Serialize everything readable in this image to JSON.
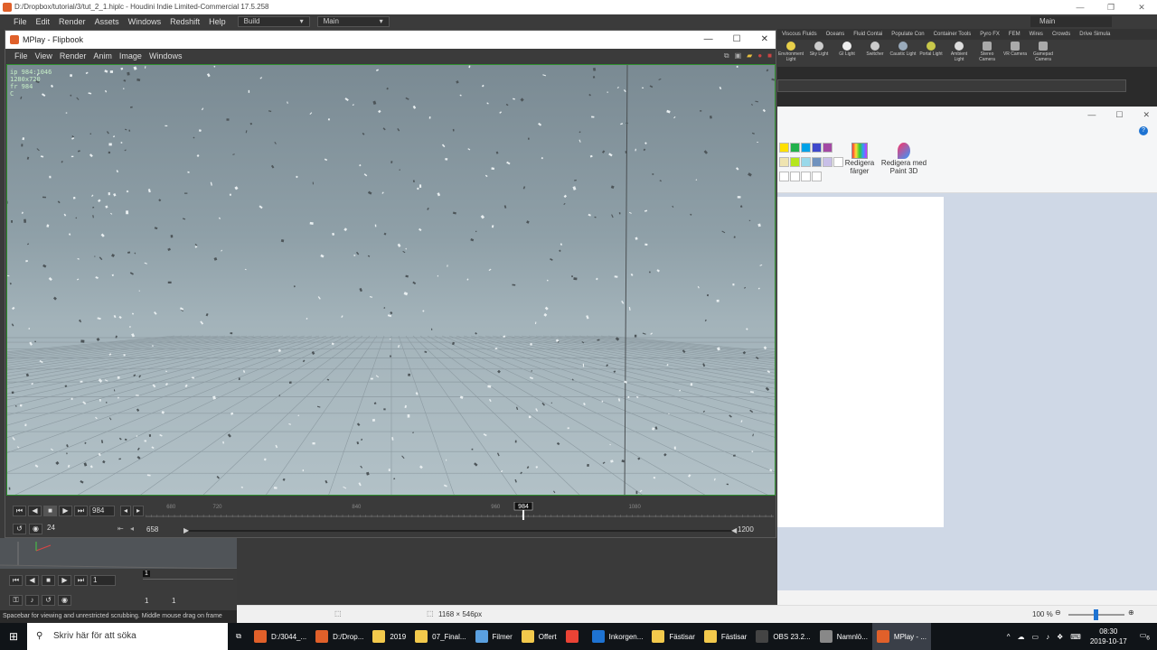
{
  "houdini": {
    "title": "D:/Dropbox/tutorial/3/tut_2_1.hiplc - Houdini Indie Limited-Commercial 17.5.258",
    "menu": [
      "File",
      "Edit",
      "Render",
      "Assets",
      "Windows",
      "Redshift",
      "Help"
    ],
    "desktop": "Build",
    "network": "Main",
    "right_desktop": "Main",
    "shelf_tabs": [
      "Viscous Fluids",
      "Oceans",
      "Fluid Contai",
      "Populate Con",
      "Container Tools",
      "Pyro FX",
      "FEM",
      "Wires",
      "Crowds",
      "Drive Simula"
    ],
    "shelf_tools": [
      "Environment Light",
      "Sky Light",
      "GI Light",
      "Switcher",
      "Caustic Light",
      "Portal Light",
      "Ambient Light",
      "Stereo Camera",
      "VR Camera",
      "Gamepad Camera"
    ],
    "status": "Spacebar for viewing and unrestricted scrubbing. Middle mouse drag on frame",
    "lower_frame": "1",
    "lower_start": "1",
    "lower_end": "1",
    "lower_frame_marker": "1"
  },
  "mplay": {
    "title": "MPlay - Flipbook",
    "menu": [
      "File",
      "View",
      "Render",
      "Anim",
      "Image",
      "Windows"
    ],
    "viewport_info": [
      "ip 984:1046",
      "1280x720",
      "fr 984",
      "C"
    ],
    "current_frame": "984",
    "fps": "24",
    "range_start": "658",
    "range_end": "1200",
    "ticks": [
      "680",
      "720",
      "840",
      "960",
      "1080"
    ],
    "timeline_frame": "984",
    "timeline": {
      "start": 658,
      "end": 1200,
      "current": 984
    }
  },
  "paint": {
    "edit_colors": "Redigera färger",
    "paint3d": "Redigera med Paint 3D",
    "size": "1168 × 546px",
    "zoom": "100 %",
    "palette": [
      "#ffe000",
      "#22b14c",
      "#00a2e8",
      "#3f48cc",
      "#a349a4",
      "#efe4b0",
      "#b5e61d",
      "#99d9ea",
      "#7092be",
      "#c8bfe7"
    ]
  },
  "taskbar": {
    "search": "Skriv här för att söka",
    "apps": [
      {
        "label": "D:/3044_...",
        "color": "#e0602a"
      },
      {
        "label": "D:/Drop...",
        "color": "#e0602a"
      },
      {
        "label": "2019",
        "color": "#f2c94c"
      },
      {
        "label": "07_Final...",
        "color": "#f2c94c"
      },
      {
        "label": "Filmer",
        "color": "#5aa0e0"
      },
      {
        "label": "Offert",
        "color": "#f2c94c"
      },
      {
        "label": "",
        "color": "#ea4335"
      },
      {
        "label": "Inkorgen...",
        "color": "#1e73d2"
      },
      {
        "label": "Fästisar",
        "color": "#f2c94c"
      },
      {
        "label": "Fästisar",
        "color": "#f2c94c"
      },
      {
        "label": "OBS 23.2...",
        "color": "#444"
      },
      {
        "label": "Namnlö...",
        "color": "#888"
      },
      {
        "label": "MPlay - ...",
        "color": "#e0602a"
      }
    ],
    "time": "08:30",
    "date": "2019-10-17",
    "notif": "6"
  }
}
